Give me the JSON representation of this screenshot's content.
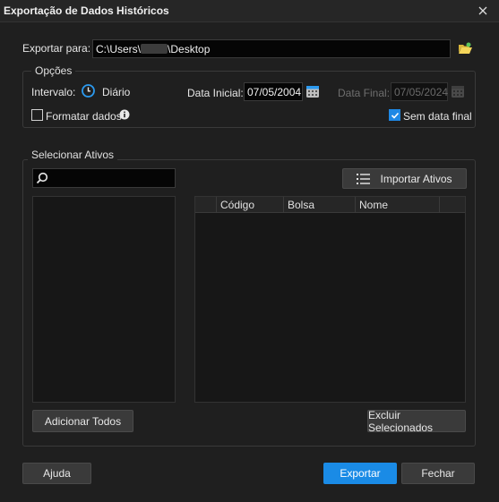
{
  "window": {
    "title": "Exportação de Dados Históricos"
  },
  "export": {
    "label": "Exportar para:",
    "path_prefix": "C:\\Users\\",
    "path_suffix": "\\Desktop"
  },
  "options": {
    "legend": "Opções",
    "interval_label": "Intervalo:",
    "interval_value": "Diário",
    "start_label": "Data Inicial:",
    "start_value": "07/05/2004",
    "end_label": "Data Final:",
    "end_value": "07/05/2024",
    "format_label": "Formatar dados",
    "format_checked": false,
    "no_end_label": "Sem data final",
    "no_end_checked": true
  },
  "assets": {
    "legend": "Selecionar Ativos",
    "search_value": "",
    "import_label": "Importar Ativos",
    "columns": [
      "Código",
      "Bolsa",
      "Nome"
    ],
    "add_all_label": "Adicionar Todos",
    "remove_selected_label": "Excluir Selecionados"
  },
  "footer": {
    "help_label": "Ajuda",
    "export_label": "Exportar",
    "close_label": "Fechar"
  },
  "colors": {
    "accent": "#1a8be6",
    "background": "#1f1f1f",
    "input": "#050505"
  }
}
